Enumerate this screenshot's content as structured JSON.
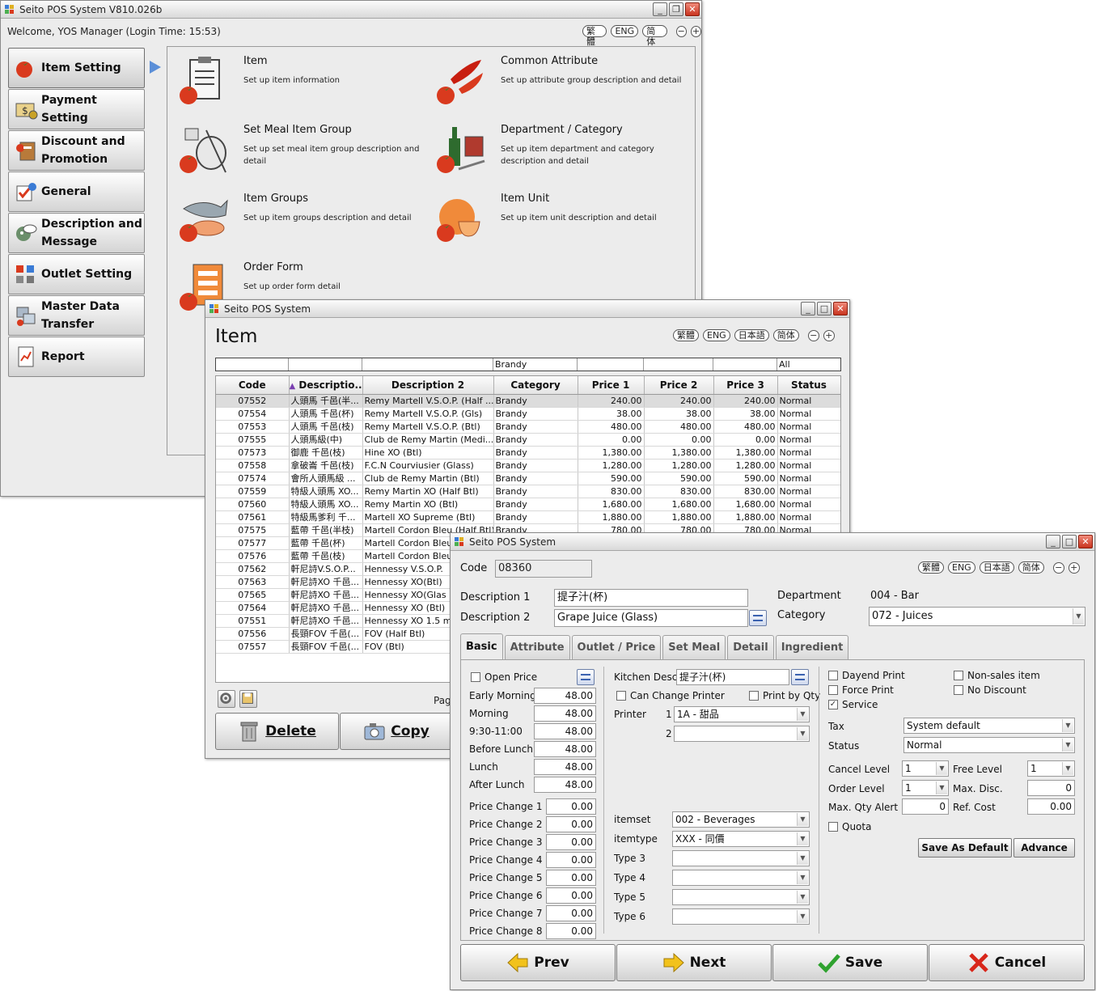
{
  "main_window": {
    "title": "Seito POS System V810.026b",
    "welcome": "Welcome, YOS Manager (Login Time: 15:53)",
    "languages": [
      "繁體",
      "ENG",
      "简体"
    ],
    "nav": [
      {
        "label": "Item Setting",
        "icon": "tomato-icon"
      },
      {
        "label": "Payment Setting",
        "icon": "money-icon"
      },
      {
        "label": "Discount and Promotion",
        "icon": "discount-icon"
      },
      {
        "label": "General",
        "icon": "checklist-icon"
      },
      {
        "label": "Description and Message",
        "icon": "message-icon"
      },
      {
        "label": "Outlet Setting",
        "icon": "outlet-icon"
      },
      {
        "label": "Master Data Transfer",
        "icon": "transfer-icon"
      },
      {
        "label": "Report",
        "icon": "report-icon"
      }
    ],
    "tiles": [
      {
        "title": "Item",
        "desc": "Set up item information",
        "icon": "clipboard-icon"
      },
      {
        "title": "Common Attribute",
        "desc": "Set up attribute group description and detail",
        "icon": "chili-icon"
      },
      {
        "title": "Set Meal Item Group",
        "desc": "Set up set meal item group description and detail",
        "icon": "dishes-icon"
      },
      {
        "title": "Department / Category",
        "desc": "Set up item department and category description and detail",
        "icon": "bottle-icon"
      },
      {
        "title": "Item Groups",
        "desc": "Set up item groups description and detail",
        "icon": "fish-icon"
      },
      {
        "title": "Item Unit",
        "desc": "Set up item unit description and detail",
        "icon": "bowl-icon"
      },
      {
        "title": "Order Form",
        "desc": "Set up order form detail",
        "icon": "order-form-icon"
      }
    ]
  },
  "item_window": {
    "title": "Seito POS System",
    "heading": "Item",
    "languages": [
      "繁體",
      "ENG",
      "日本語",
      "简体"
    ],
    "filters": [
      "",
      "",
      "",
      "Brandy",
      "",
      "",
      "",
      "All"
    ],
    "columns": [
      "Code",
      "Descriptio...",
      "Description 2",
      "Category",
      "Price 1",
      "Price 2",
      "Price 3",
      "Status"
    ],
    "rows": [
      [
        "07552",
        "人頭馬 千邑(半...",
        "Remy Martell V.S.O.P. (Half ...",
        "Brandy",
        "240.00",
        "240.00",
        "240.00",
        "Normal"
      ],
      [
        "07554",
        "人頭馬 千邑(杯)",
        "Remy Martell V.S.O.P. (Gls)",
        "Brandy",
        "38.00",
        "38.00",
        "38.00",
        "Normal"
      ],
      [
        "07553",
        "人頭馬 千邑(枝)",
        "Remy Martell V.S.O.P. (Btl)",
        "Brandy",
        "480.00",
        "480.00",
        "480.00",
        "Normal"
      ],
      [
        "07555",
        "人頭馬級(中)",
        "Club de Remy Martin (Medi...",
        "Brandy",
        "0.00",
        "0.00",
        "0.00",
        "Normal"
      ],
      [
        "07573",
        "御鹿 千邑(枝)",
        "Hine XO (Btl)",
        "Brandy",
        "1,380.00",
        "1,380.00",
        "1,380.00",
        "Normal"
      ],
      [
        "07558",
        "拿破崙 千邑(枝)",
        "F.C.N Courviusier (Glass)",
        "Brandy",
        "1,280.00",
        "1,280.00",
        "1,280.00",
        "Normal"
      ],
      [
        "07574",
        "會所人頭馬級 ...",
        "Club de Remy Martin (Btl)",
        "Brandy",
        "590.00",
        "590.00",
        "590.00",
        "Normal"
      ],
      [
        "07559",
        "特級人頭馬 XO...",
        "Remy Martin XO (Half Btl)",
        "Brandy",
        "830.00",
        "830.00",
        "830.00",
        "Normal"
      ],
      [
        "07560",
        "特級人頭馬 XO...",
        "Remy Martin XO (Btl)",
        "Brandy",
        "1,680.00",
        "1,680.00",
        "1,680.00",
        "Normal"
      ],
      [
        "07561",
        "特級馬爹利 千...",
        "Martell XO Supreme (Btl)",
        "Brandy",
        "1,880.00",
        "1,880.00",
        "1,880.00",
        "Normal"
      ],
      [
        "07575",
        "藍帶 千邑(半枝)",
        "Martell Cordon Bleu (Half Btl)",
        "Brandy",
        "780.00",
        "780.00",
        "780.00",
        "Normal"
      ],
      [
        "07577",
        "藍帶 千邑(杯)",
        "Martell Cordon Bleu",
        "",
        "",
        "",
        "",
        ""
      ],
      [
        "07576",
        "藍帶 千邑(枝)",
        "Martell Cordon Bleu",
        "",
        "",
        "",
        "",
        ""
      ],
      [
        "07562",
        "軒尼詩V.S.O.P...",
        "Hennessy V.S.O.P.",
        "",
        "",
        "",
        "",
        ""
      ],
      [
        "07563",
        "軒尼詩XO 千邑...",
        "Hennessy XO(Btl)",
        "",
        "",
        "",
        "",
        ""
      ],
      [
        "07565",
        "軒尼詩XO 千邑...",
        "Hennessy XO(Glas",
        "",
        "",
        "",
        "",
        ""
      ],
      [
        "07564",
        "軒尼詩XO 千邑...",
        "Hennessy XO (Btl)",
        "",
        "",
        "",
        "",
        ""
      ],
      [
        "07551",
        "軒尼詩XO 千邑...",
        "Hennessy XO 1.5 m",
        "",
        "",
        "",
        "",
        ""
      ],
      [
        "07556",
        "長頸FOV 千邑(...",
        "FOV (Half Btl)",
        "",
        "",
        "",
        "",
        ""
      ],
      [
        "07557",
        "長頸FOV 千邑(...",
        "FOV (Btl)",
        "",
        "",
        "",
        "",
        ""
      ]
    ],
    "pager_text": "Pag",
    "delete_label": "Delete",
    "copy_label": "Copy"
  },
  "detail_window": {
    "title": "Seito POS System",
    "languages": [
      "繁體",
      "ENG",
      "日本語",
      "简体"
    ],
    "code_label": "Code",
    "code_value": "08360",
    "desc1_label": "Description 1",
    "desc1_value": "提子汁(杯)",
    "desc2_label": "Description 2",
    "desc2_value": "Grape Juice (Glass)",
    "department_label": "Department",
    "department_value": "004 - Bar",
    "category_label": "Category",
    "category_value": "072 - Juices",
    "tabs": [
      "Basic",
      "Attribute",
      "Outlet / Price",
      "Set Meal",
      "Detail",
      "Ingredient"
    ],
    "open_price_label": "Open Price",
    "prices": [
      {
        "label": "Early Morning",
        "value": "48.00"
      },
      {
        "label": "Morning",
        "value": "48.00"
      },
      {
        "label": "9:30-11:00",
        "value": "48.00"
      },
      {
        "label": "Before Lunch",
        "value": "48.00"
      },
      {
        "label": "Lunch",
        "value": "48.00"
      },
      {
        "label": "After Lunch",
        "value": "48.00"
      }
    ],
    "price_changes": [
      {
        "label": "Price Change 1",
        "value": "0.00"
      },
      {
        "label": "Price Change 2",
        "value": "0.00"
      },
      {
        "label": "Price Change 3",
        "value": "0.00"
      },
      {
        "label": "Price Change 4",
        "value": "0.00"
      },
      {
        "label": "Price Change 5",
        "value": "0.00"
      },
      {
        "label": "Price Change 6",
        "value": "0.00"
      },
      {
        "label": "Price Change 7",
        "value": "0.00"
      },
      {
        "label": "Price Change 8",
        "value": "0.00"
      }
    ],
    "kitchen_desc_label": "Kitchen Desc.",
    "kitchen_desc_value": "提子汁(杯)",
    "can_change_printer_label": "Can Change Printer",
    "print_by_qty_label": "Print by Qty",
    "printer_label": "Printer",
    "printer1_num": "1",
    "printer1_value": "1A - 甜品",
    "printer2_num": "2",
    "printer2_value": "",
    "itemset_label": "itemset",
    "itemset_value": "002 - Beverages",
    "itemtype_label": "itemtype",
    "itemtype_value": "XXX - 同價",
    "type3_label": "Type 3",
    "type4_label": "Type 4",
    "type5_label": "Type 5",
    "type6_label": "Type 6",
    "dayend_print_label": "Dayend Print",
    "non_sales_label": "Non-sales item",
    "force_print_label": "Force Print",
    "no_discount_label": "No Discount",
    "service_label": "Service",
    "service_checked": true,
    "tax_label": "Tax",
    "tax_value": "System default",
    "status_label": "Status",
    "status_value": "Normal",
    "cancel_level_label": "Cancel Level",
    "cancel_level_value": "1",
    "free_level_label": "Free Level",
    "free_level_value": "1",
    "order_level_label": "Order Level",
    "order_level_value": "1",
    "max_disc_label": "Max. Disc.",
    "max_disc_value": "0",
    "max_qty_alert_label": "Max. Qty Alert",
    "max_qty_alert_value": "0",
    "ref_cost_label": "Ref. Cost",
    "ref_cost_value": "0.00",
    "quota_label": "Quota",
    "save_default_label": "Save As Default",
    "advance_label": "Advance",
    "prev_label": "Prev",
    "next_label": "Next",
    "save_label": "Save",
    "cancel_label": "Cancel"
  },
  "colors": {
    "accent": "#5b8fd8",
    "tomato": "#d93a1e",
    "close": "#c8331e",
    "save_check": "#2fa22f",
    "cancel_x": "#d8261a",
    "arrow_yellow": "#f2c21b"
  }
}
